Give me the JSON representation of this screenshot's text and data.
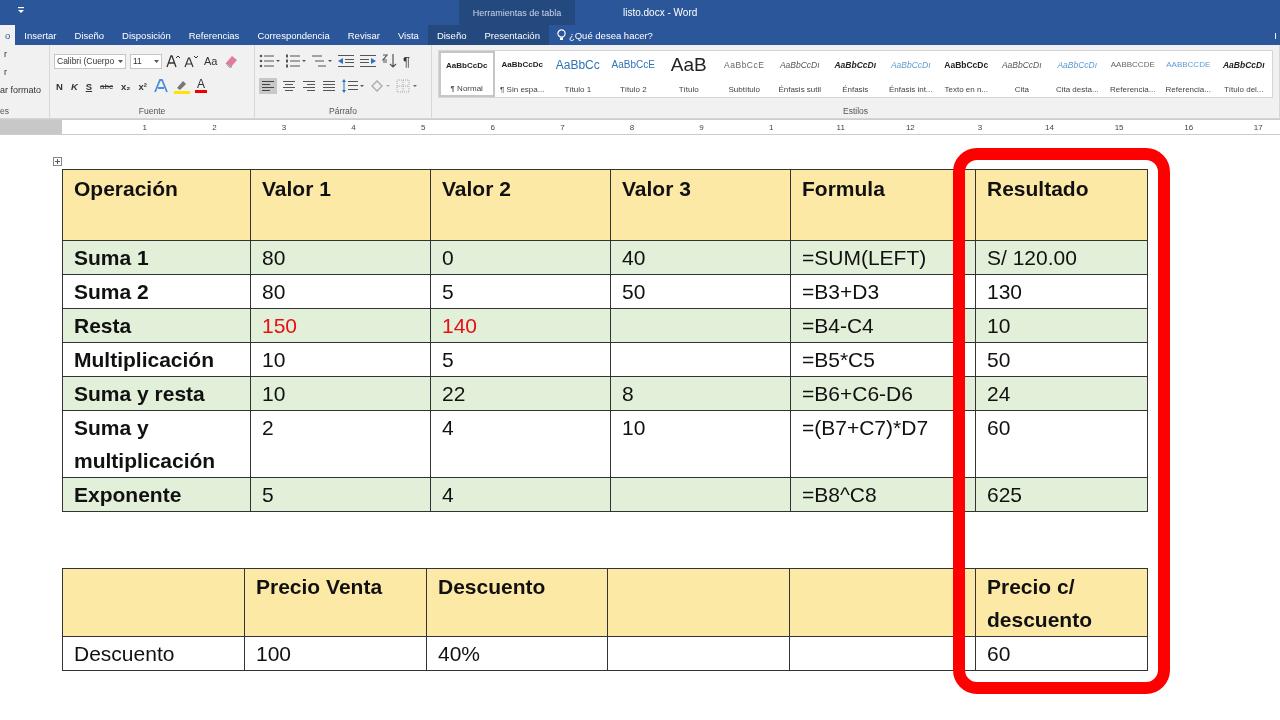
{
  "title_bar": {
    "context_label": "Herramientas de tabla",
    "title": "listo.docx - Word"
  },
  "tabs": [
    {
      "label": "o",
      "selected": true,
      "context": false
    },
    {
      "label": "Insertar",
      "selected": false,
      "context": false
    },
    {
      "label": "Diseño",
      "selected": false,
      "context": false
    },
    {
      "label": "Disposición",
      "selected": false,
      "context": false
    },
    {
      "label": "Referencias",
      "selected": false,
      "context": false
    },
    {
      "label": "Correspondencia",
      "selected": false,
      "context": false
    },
    {
      "label": "Revisar",
      "selected": false,
      "context": false
    },
    {
      "label": "Vista",
      "selected": false,
      "context": false
    },
    {
      "label": "Diseño",
      "selected": false,
      "context": true
    },
    {
      "label": "Presentación",
      "selected": false,
      "context": true
    }
  ],
  "tell_me": {
    "placeholder": "¿Qué desea hacer?"
  },
  "account": "I",
  "ribbon": {
    "clipboard": {
      "items": [
        "r",
        "r",
        "ar formato"
      ],
      "label": "es"
    },
    "font": {
      "label": "Fuente",
      "font_name": "Calibri (Cuerpo",
      "size": "11",
      "case_button": "Aa",
      "format_buttons": [
        "N",
        "K",
        "S",
        "abc",
        "x₂",
        "x²"
      ],
      "color_letter": "A"
    },
    "paragraph": {
      "label": "Párrafo",
      "pilcrow": "¶"
    },
    "styles": {
      "label": "Estilos",
      "items": [
        {
          "preview": "AaBbCcDc",
          "name": "¶ Normal",
          "selected": true
        },
        {
          "preview": "AaBbCcDc",
          "name": "¶ Sin espa...",
          "selected": false
        },
        {
          "preview": "AaBbCc",
          "name": "Título 1",
          "selected": false
        },
        {
          "preview": "AaBbCcE",
          "name": "Título 2",
          "selected": false
        },
        {
          "preview": "AaB",
          "name": "Título",
          "selected": false
        },
        {
          "preview": "AaBbCcE",
          "name": "Subtítulo",
          "selected": false
        },
        {
          "preview": "AaBbCcDı",
          "name": "Énfasis sutil",
          "selected": false
        },
        {
          "preview": "AaBbCcDı",
          "name": "Énfasis",
          "selected": false
        },
        {
          "preview": "AaBbCcDı",
          "name": "Énfasis int...",
          "selected": false
        },
        {
          "preview": "AaBbCcDc",
          "name": "Texto en n...",
          "selected": false
        },
        {
          "preview": "AaBbCcDı",
          "name": "Cita",
          "selected": false
        },
        {
          "preview": "AaBbCcDı",
          "name": "Cita desta...",
          "selected": false
        },
        {
          "preview": "AABBCCDE",
          "name": "Referencia...",
          "selected": false
        },
        {
          "preview": "AABBCCDE",
          "name": "Referencia...",
          "selected": false
        },
        {
          "preview": "AaBbCcDı",
          "name": "Título del...",
          "selected": false
        }
      ]
    }
  },
  "ruler": [
    "1",
    "2",
    "3",
    "4",
    "5",
    "6",
    "7",
    "8",
    "9",
    "1",
    "11",
    "12",
    "3",
    "14",
    "15",
    "16",
    "17"
  ],
  "table_1": {
    "columns": [
      "Operación",
      "Valor 1",
      "Valor 2",
      "Valor 3",
      "Formula",
      "Resultado"
    ],
    "rows": [
      {
        "shaded": true,
        "cells": [
          {
            "text": "Suma 1"
          },
          {
            "text": "80"
          },
          {
            "text": "0"
          },
          {
            "text": "40"
          },
          {
            "text": "=SUM(LEFT)"
          },
          {
            "text": "S/ 120.00"
          }
        ]
      },
      {
        "shaded": false,
        "cells": [
          {
            "text": "Suma 2"
          },
          {
            "text": "80"
          },
          {
            "text": "5"
          },
          {
            "text": "50"
          },
          {
            "text": "=B3+D3"
          },
          {
            "text": "130"
          }
        ]
      },
      {
        "shaded": true,
        "cells": [
          {
            "text": "Resta"
          },
          {
            "text": "150",
            "color": "#e81010"
          },
          {
            "text": "140",
            "color": "#e81010"
          },
          {
            "text": ""
          },
          {
            "text": "=B4-C4"
          },
          {
            "text": "10"
          }
        ]
      },
      {
        "shaded": false,
        "cells": [
          {
            "text": "Multiplicación"
          },
          {
            "text": "10"
          },
          {
            "text": "5"
          },
          {
            "text": ""
          },
          {
            "text": "=B5*C5"
          },
          {
            "text": "50"
          }
        ]
      },
      {
        "shaded": true,
        "cells": [
          {
            "text": "Suma y resta"
          },
          {
            "text": "10"
          },
          {
            "text": "22"
          },
          {
            "text": "8"
          },
          {
            "text": "=B6+C6-D6"
          },
          {
            "text": "24"
          }
        ]
      },
      {
        "shaded": false,
        "cells": [
          {
            "text": "Suma y multiplicación"
          },
          {
            "text": "2"
          },
          {
            "text": "4"
          },
          {
            "text": "10"
          },
          {
            "text": "=(B7+C7)*D7"
          },
          {
            "text": "60"
          }
        ]
      },
      {
        "shaded": true,
        "cells": [
          {
            "text": "Exponente"
          },
          {
            "text": "5"
          },
          {
            "text": "4"
          },
          {
            "text": ""
          },
          {
            "text": "=B8^C8"
          },
          {
            "text": "625"
          }
        ]
      }
    ]
  },
  "table_2": {
    "columns": [
      "",
      "Precio Venta",
      "Descuento",
      "",
      "",
      "Precio c/ descuento"
    ],
    "rows": [
      {
        "cells": [
          "Descuento",
          "100",
          "40%",
          "",
          "",
          "60"
        ]
      }
    ]
  }
}
